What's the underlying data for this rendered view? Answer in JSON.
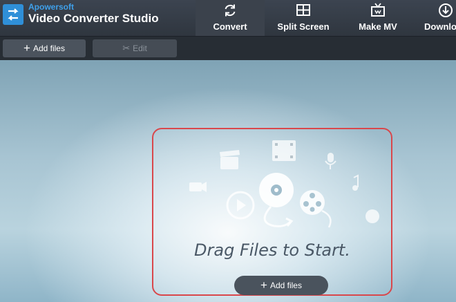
{
  "app": {
    "company": "Apowersoft",
    "name": "Video Converter Studio"
  },
  "tabs": [
    {
      "label": "Convert",
      "icon": "refresh-icon",
      "active": true
    },
    {
      "label": "Split Screen",
      "icon": "split-screen-icon",
      "active": false
    },
    {
      "label": "Make MV",
      "icon": "tv-icon",
      "active": false
    },
    {
      "label": "Download",
      "icon": "download-icon",
      "active": false
    }
  ],
  "toolbar": {
    "add_files": "Add files",
    "edit": "Edit"
  },
  "dropzone": {
    "message": "Drag Files to Start.",
    "add_files": "Add files"
  },
  "colors": {
    "accent": "#3fa0ea",
    "highlight_border": "#d9474b"
  }
}
